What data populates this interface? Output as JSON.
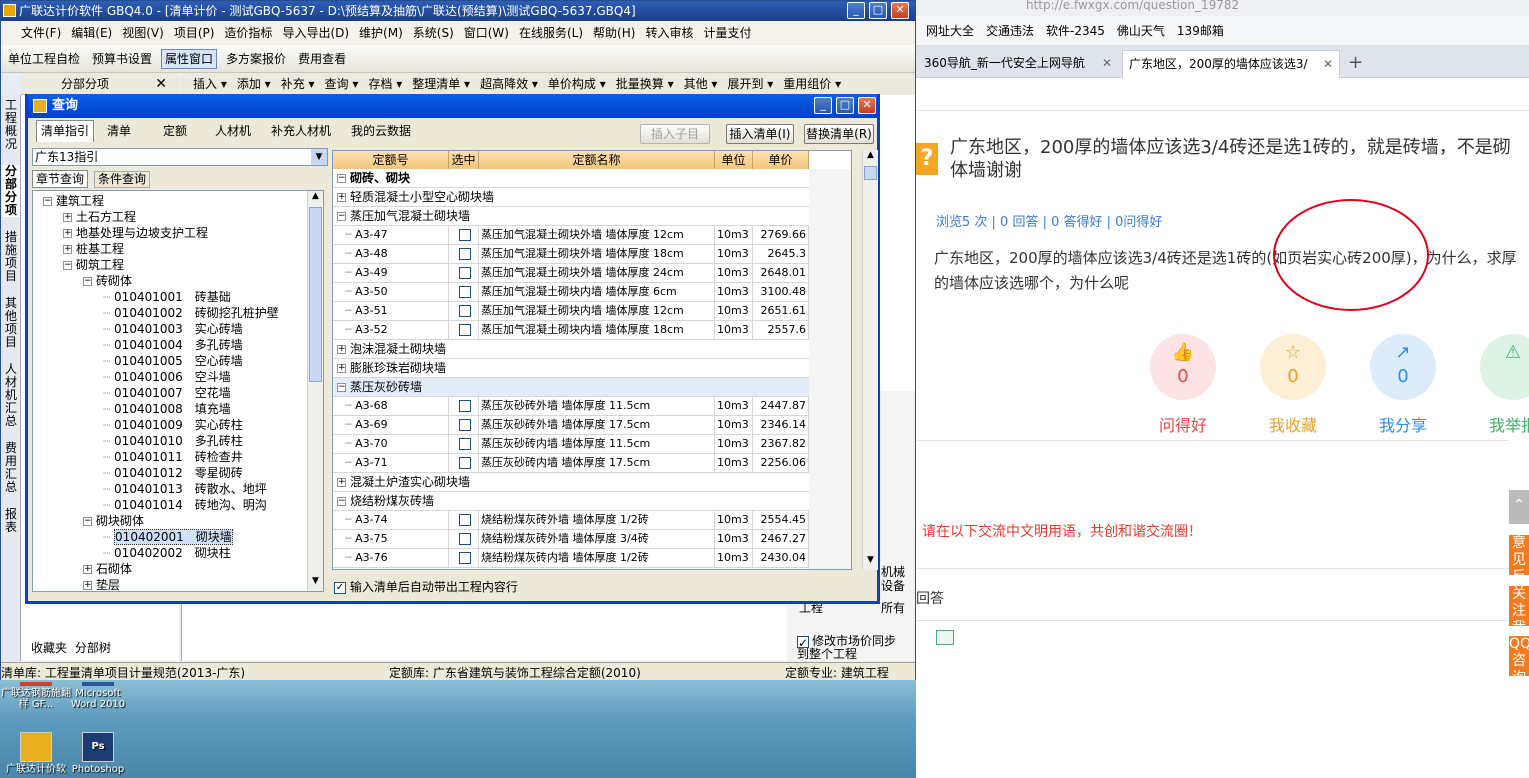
{
  "app": {
    "title": "广联达计价软件 GBQ4.0 - [清单计价 - 测试GBQ-5637 - D:\\预结算及抽筋\\广联达(预结算)\\测试GBQ-5637.GBQ4]",
    "menu": [
      "文件(F)",
      "编辑(E)",
      "视图(V)",
      "项目(P)",
      "造价指标",
      "导入导出(D)",
      "维护(M)",
      "系统(S)",
      "窗口(W)",
      "在线服务(L)",
      "帮助(H)",
      "转入审核",
      "计量支付"
    ],
    "toolbar": [
      "单位工程自检",
      "预算书设置",
      "属性窗口",
      "多方案报价",
      "费用查看"
    ],
    "toolbar2": [
      "插入",
      "添加",
      "补充",
      "查询",
      "存档",
      "整理清单",
      "超高降效",
      "单价构成",
      "批量换算",
      "其他",
      "展开到",
      "重用组价"
    ],
    "left_header": "分部分项",
    "side_tabs": [
      "工程概况",
      "分部分项",
      "措施项目",
      "其他项目",
      "人材机汇总",
      "费用汇总",
      "报表"
    ],
    "bottom_tabs": [
      "收藏夹",
      "分部树"
    ],
    "status": {
      "bill_lib": "清单库: 工程量清单项目计量规范(2013-广东)",
      "quota_lib": "定额库: 广东省建筑与装饰工程综合定额(2010)",
      "quota_major": "定额专业: 建筑工程"
    },
    "right_fragments": [
      "口",
      "口",
      "机械",
      "设备",
      "所有",
      "工程",
      "修改市场价同步到整个工程"
    ]
  },
  "dialog": {
    "title": "查询",
    "tabs": [
      "清单指引",
      "清单",
      "定额",
      "人材机",
      "补充人材机",
      "我的云数据"
    ],
    "buttons": {
      "insert_sub": "插入子目",
      "insert_bill": "插入清单(I)",
      "replace_bill": "替换清单(R)"
    },
    "guide_select": "广东13指引",
    "sub_tabs": [
      "章节查询",
      "条件查询"
    ],
    "tree": [
      {
        "text": "建筑工程",
        "level": 0,
        "box": "−"
      },
      {
        "text": "土石方工程",
        "level": 1,
        "box": "+"
      },
      {
        "text": "地基处理与边坡支护工程",
        "level": 1,
        "box": "+"
      },
      {
        "text": "桩基工程",
        "level": 1,
        "box": "+"
      },
      {
        "text": "砌筑工程",
        "level": 1,
        "box": "−"
      },
      {
        "text": "砖砌体",
        "level": 2,
        "box": "−"
      },
      {
        "text": "010401001　砖基础",
        "level": 3,
        "box": ""
      },
      {
        "text": "010401002　砖砌挖孔桩护壁",
        "level": 3,
        "box": ""
      },
      {
        "text": "010401003　实心砖墙",
        "level": 3,
        "box": ""
      },
      {
        "text": "010401004　多孔砖墙",
        "level": 3,
        "box": ""
      },
      {
        "text": "010401005　空心砖墙",
        "level": 3,
        "box": ""
      },
      {
        "text": "010401006　空斗墙",
        "level": 3,
        "box": ""
      },
      {
        "text": "010401007　空花墙",
        "level": 3,
        "box": ""
      },
      {
        "text": "010401008　填充墙",
        "level": 3,
        "box": ""
      },
      {
        "text": "010401009　实心砖柱",
        "level": 3,
        "box": ""
      },
      {
        "text": "010401010　多孔砖柱",
        "level": 3,
        "box": ""
      },
      {
        "text": "010401011　砖检查井",
        "level": 3,
        "box": ""
      },
      {
        "text": "010401012　零星砌砖",
        "level": 3,
        "box": ""
      },
      {
        "text": "010401013　砖散水、地坪",
        "level": 3,
        "box": ""
      },
      {
        "text": "010401014　砖地沟、明沟",
        "level": 3,
        "box": ""
      },
      {
        "text": "砌块砌体",
        "level": 2,
        "box": "−"
      },
      {
        "text": "010402001　砌块墙",
        "level": 3,
        "box": "",
        "selected": true
      },
      {
        "text": "010402002　砌块柱",
        "level": 3,
        "box": ""
      },
      {
        "text": "石砌体",
        "level": 2,
        "box": "+"
      },
      {
        "text": "垫层",
        "level": 2,
        "box": "+"
      }
    ],
    "grid_headers": [
      "定额号",
      "选中",
      "定额名称",
      "单位",
      "单价"
    ],
    "grid_rows": [
      {
        "type": "group",
        "box": "−",
        "name": "砌砖、砌块",
        "bold": true
      },
      {
        "type": "group",
        "box": "+",
        "name": "轻质混凝土小型空心砌块墙"
      },
      {
        "type": "group",
        "box": "−",
        "name": "蒸压加气混凝土砌块墙"
      },
      {
        "type": "item",
        "code": "A3-47",
        "name": "蒸压加气混凝土砌块外墙 墙体厚度 12cm",
        "unit": "10m3",
        "price": "2769.66"
      },
      {
        "type": "item",
        "code": "A3-48",
        "name": "蒸压加气混凝土砌块外墙 墙体厚度 18cm",
        "unit": "10m3",
        "price": "2645.3"
      },
      {
        "type": "item",
        "code": "A3-49",
        "name": "蒸压加气混凝土砌块外墙 墙体厚度 24cm",
        "unit": "10m3",
        "price": "2648.01"
      },
      {
        "type": "item",
        "code": "A3-50",
        "name": "蒸压加气混凝土砌块内墙 墙体厚度 6cm",
        "unit": "10m3",
        "price": "3100.48"
      },
      {
        "type": "item",
        "code": "A3-51",
        "name": "蒸压加气混凝土砌块内墙 墙体厚度 12cm",
        "unit": "10m3",
        "price": "2651.61"
      },
      {
        "type": "item",
        "code": "A3-52",
        "name": "蒸压加气混凝土砌块内墙 墙体厚度 18cm",
        "unit": "10m3",
        "price": "2557.6"
      },
      {
        "type": "group",
        "box": "+",
        "name": "泡沫混凝土砌块墙"
      },
      {
        "type": "group",
        "box": "+",
        "name": "膨胀珍珠岩砌块墙"
      },
      {
        "type": "group",
        "box": "−",
        "name": "蒸压灰砂砖墙",
        "hl": true
      },
      {
        "type": "item",
        "code": "A3-68",
        "name": "蒸压灰砂砖外墙 墙体厚度 11.5cm",
        "unit": "10m3",
        "price": "2447.87"
      },
      {
        "type": "item",
        "code": "A3-69",
        "name": "蒸压灰砂砖外墙 墙体厚度 17.5cm",
        "unit": "10m3",
        "price": "2346.14"
      },
      {
        "type": "item",
        "code": "A3-70",
        "name": "蒸压灰砂砖内墙 墙体厚度 11.5cm",
        "unit": "10m3",
        "price": "2367.82"
      },
      {
        "type": "item",
        "code": "A3-71",
        "name": "蒸压灰砂砖内墙 墙体厚度 17.5cm",
        "unit": "10m3",
        "price": "2256.06"
      },
      {
        "type": "group",
        "box": "+",
        "name": "混凝土炉渣实心砌块墙"
      },
      {
        "type": "group",
        "box": "−",
        "name": "烧结粉煤灰砖墙"
      },
      {
        "type": "item",
        "code": "A3-74",
        "name": "烧结粉煤灰砖外墙 墙体厚度 1/2砖",
        "unit": "10m3",
        "price": "2554.45"
      },
      {
        "type": "item",
        "code": "A3-75",
        "name": "烧结粉煤灰砖外墙 墙体厚度 3/4砖",
        "unit": "10m3",
        "price": "2467.27"
      },
      {
        "type": "item",
        "code": "A3-76",
        "name": "烧结粉煤灰砖内墙 墙体厚度 1/2砖",
        "unit": "10m3",
        "price": "2430.04"
      }
    ],
    "auto_checkbox": "输入清单后自动带出工程内容行"
  },
  "desktop": {
    "icons": [
      {
        "label": "广联达钢筋施翻样 GF...",
        "color": "#d04030"
      },
      {
        "label": "Microsoft Word 2010",
        "color": "#2b5797"
      },
      {
        "label": "广联达计价软",
        "color": "#e8b020"
      },
      {
        "label": "Photoshop",
        "color": "#1b3d73",
        "glyph": "Ps"
      }
    ]
  },
  "browser": {
    "address_fragment": "http://e.fwxgx.com/question_19782",
    "favorites": [
      "网址大全",
      "交通违法",
      "软件-2345",
      "佛山天气",
      "139邮箱"
    ],
    "tabs": [
      {
        "label": "360导航_新一代安全上网导航",
        "active": false
      },
      {
        "label": "广东地区，200厚的墙体应该选3/",
        "active": true
      }
    ],
    "question": {
      "title": "广东地区，200厚的墙体应该选3/4砖还是选1砖的，就是砖墙，不是砌体墙谢谢",
      "stats": "浏览5 次 | 0 回答 | 0 答得好 | 0问得好",
      "body": "广东地区，200厚的墙体应该选3/4砖还是选1砖的(如页岩实心砖200厚)，为什么，求厚的墙体应该选哪个，为什么呢"
    },
    "actions": [
      {
        "label": "问得好",
        "count": "0",
        "color": "#e8474c",
        "bg": "#fde3e4",
        "icon": "thumb-up-icon",
        "glyph": "👍"
      },
      {
        "label": "我收藏",
        "count": "0",
        "color": "#e3a32c",
        "bg": "#fcefd5",
        "icon": "star-icon",
        "glyph": "☆"
      },
      {
        "label": "我分享",
        "count": "0",
        "color": "#2f8de4",
        "bg": "#dcecfb",
        "icon": "share-icon",
        "glyph": "↗"
      },
      {
        "label": "我举报",
        "count": "",
        "color": "#3db36a",
        "bg": "#ddf3e5",
        "icon": "warning-icon",
        "glyph": "⚠"
      }
    ],
    "warning": "请在以下交流中文明用语，共创和谐交流圈！",
    "answer_label": "回答",
    "side_buttons": [
      "意见反馈",
      "关注我",
      "QQ咨询"
    ]
  }
}
